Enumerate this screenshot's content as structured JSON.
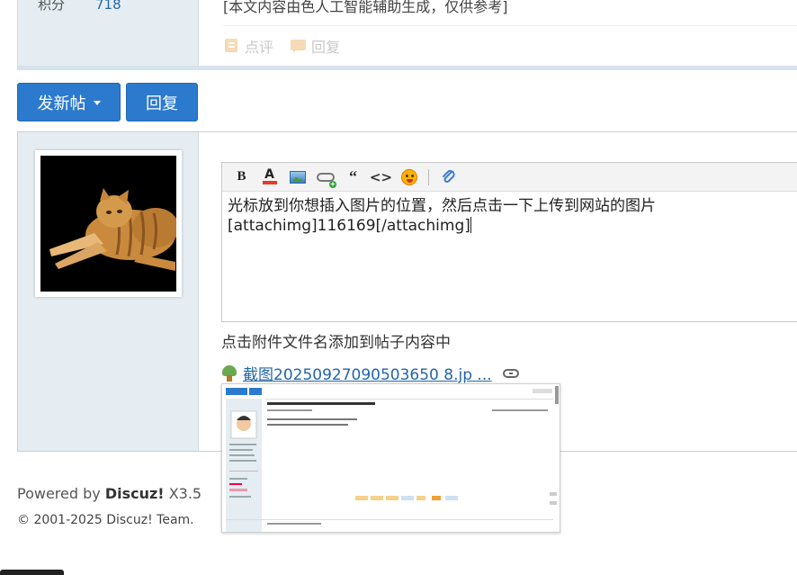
{
  "prev_post": {
    "side_label": "积分",
    "side_value": "718",
    "content_text": "[本文内容由色人工智能辅助生成，仅供参考]",
    "actions": {
      "comment_label": "点评",
      "reply_label": "回复"
    }
  },
  "buttons": {
    "new_post_label": "发新帖",
    "reply_label": "回复"
  },
  "editor": {
    "toolbar": [
      "bold-icon",
      "font-color-icon",
      "image-icon",
      "link-icon",
      "quote-icon",
      "code-icon",
      "smiley-icon",
      "attachment-icon"
    ],
    "line1": "光标放到你想插入图片的位置，然后点击一下上传到网站的图片",
    "line2": "[attachimg]116169[/attachimg]"
  },
  "attachments": {
    "hint": "点击附件文件名添加到帖子内容中",
    "file_name": "截图20250927090503650 8.jp ..."
  },
  "footer": {
    "powered_prefix": "Powered by ",
    "powered_brand": "Discuz!",
    "powered_version": " X3.5",
    "copyright": "© 2001-2025 Discuz! Team."
  },
  "colors": {
    "primary": "#2b7acd",
    "sidebar": "#e5edf2",
    "link": "#2366a8"
  }
}
